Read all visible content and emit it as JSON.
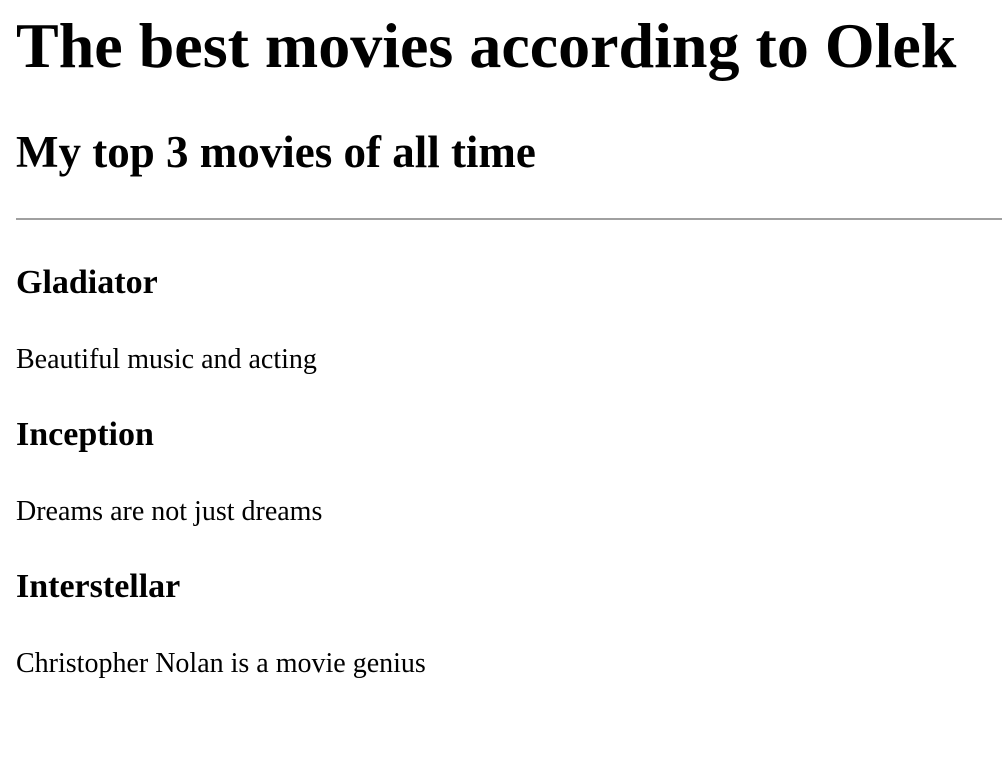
{
  "page": {
    "title": "The best movies according to Olek",
    "subtitle": "My top 3 movies of all time"
  },
  "movies": [
    {
      "title": "Gladiator",
      "description": "Beautiful music and acting"
    },
    {
      "title": "Inception",
      "description": "Dreams are not just dreams"
    },
    {
      "title": "Interstellar",
      "description": "Christopher Nolan is a movie genius"
    }
  ]
}
